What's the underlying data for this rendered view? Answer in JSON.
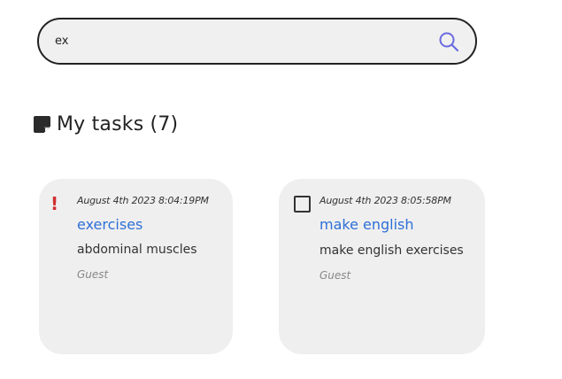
{
  "search": {
    "value": "ex",
    "placeholder": ""
  },
  "heading": {
    "text": "My tasks (7)"
  },
  "icons": {
    "search": "search-icon",
    "note": "sticky-note-icon",
    "priority": "exclamation-icon",
    "checkbox": "checkbox-icon"
  },
  "colors": {
    "accent": "#6b6be0",
    "title_link": "#2e6fd6",
    "priority": "#d32f2f",
    "card_bg": "#efefef"
  },
  "tasks": [
    {
      "date": "August 4th 2023 8:04:19PM",
      "title": "exercises",
      "description": "abdominal muscles",
      "author": "Guest",
      "marker": "!"
    },
    {
      "date": "August 4th 2023 8:05:58PM",
      "title": "make english",
      "description": "make english exercises",
      "author": "Guest",
      "marker": "checkbox"
    }
  ]
}
